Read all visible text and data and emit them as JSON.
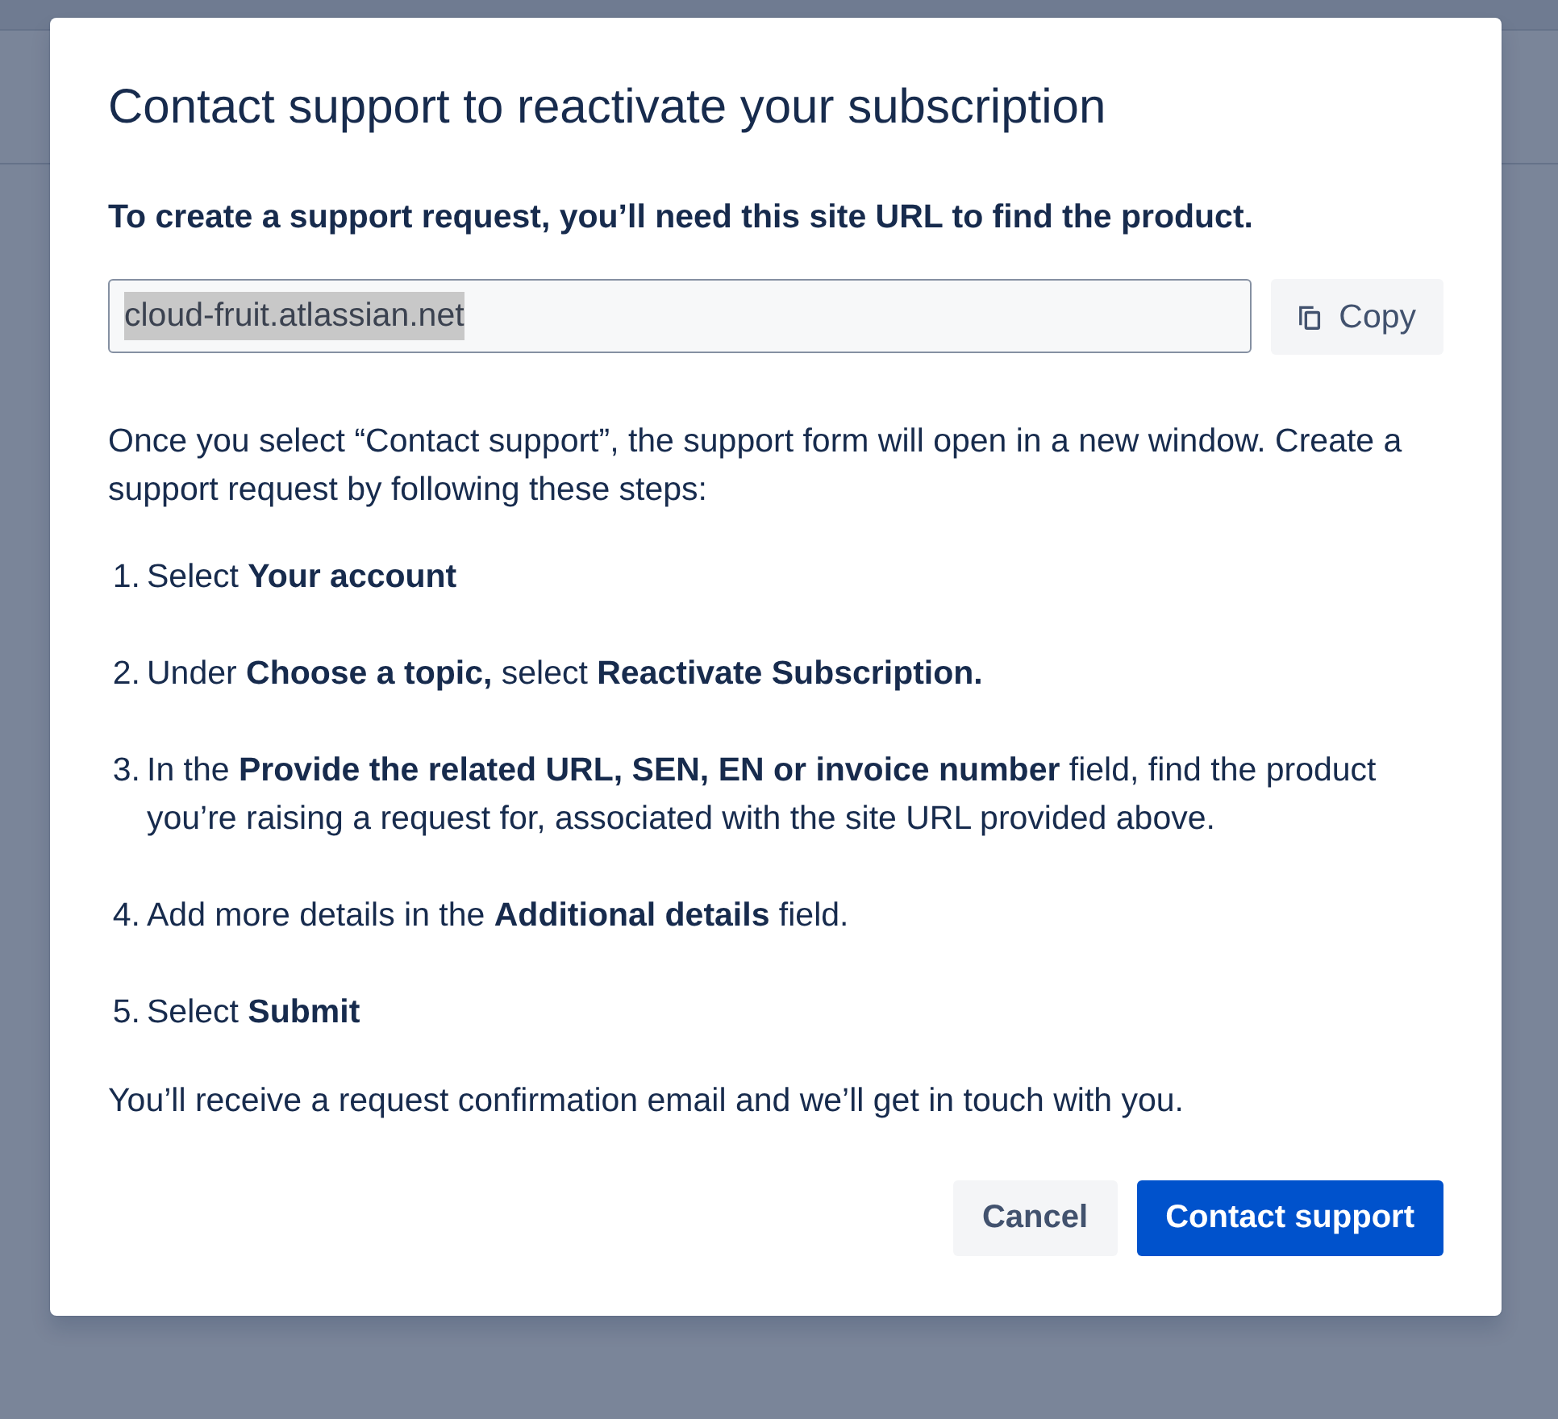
{
  "dialog": {
    "title": "Contact support to reactivate your subscription",
    "intro": "To create a support request, you’ll need this site URL to find the product.",
    "url_field": {
      "value": "cloud-fruit.atlassian.net",
      "text_selected": true
    },
    "copy_button": {
      "label": "Copy"
    },
    "description": "Once you select “Contact support”, the support form will open in a new window. Create a support request by following these steps:",
    "steps": [
      {
        "number": "1.",
        "text": "Select **Your account**"
      },
      {
        "number": "2.",
        "text": "Under **Choose a topic,** select **Reactivate Subscription.**"
      },
      {
        "number": "3.",
        "text": "In the **Provide the related URL, SEN, EN or invoice number** field, find the product you’re raising a request for, associated with the site URL provided above."
      },
      {
        "number": "4.",
        "text": "Add more details in the **Additional details** field."
      },
      {
        "number": "5.",
        "text": "Select **Submit**"
      }
    ],
    "closing": "You’ll receive a request confirmation email and we’ll get in touch with you.",
    "buttons": [
      {
        "label": "Cancel",
        "kind": "subtle"
      },
      {
        "label": "Contact support",
        "kind": "primary"
      }
    ]
  }
}
